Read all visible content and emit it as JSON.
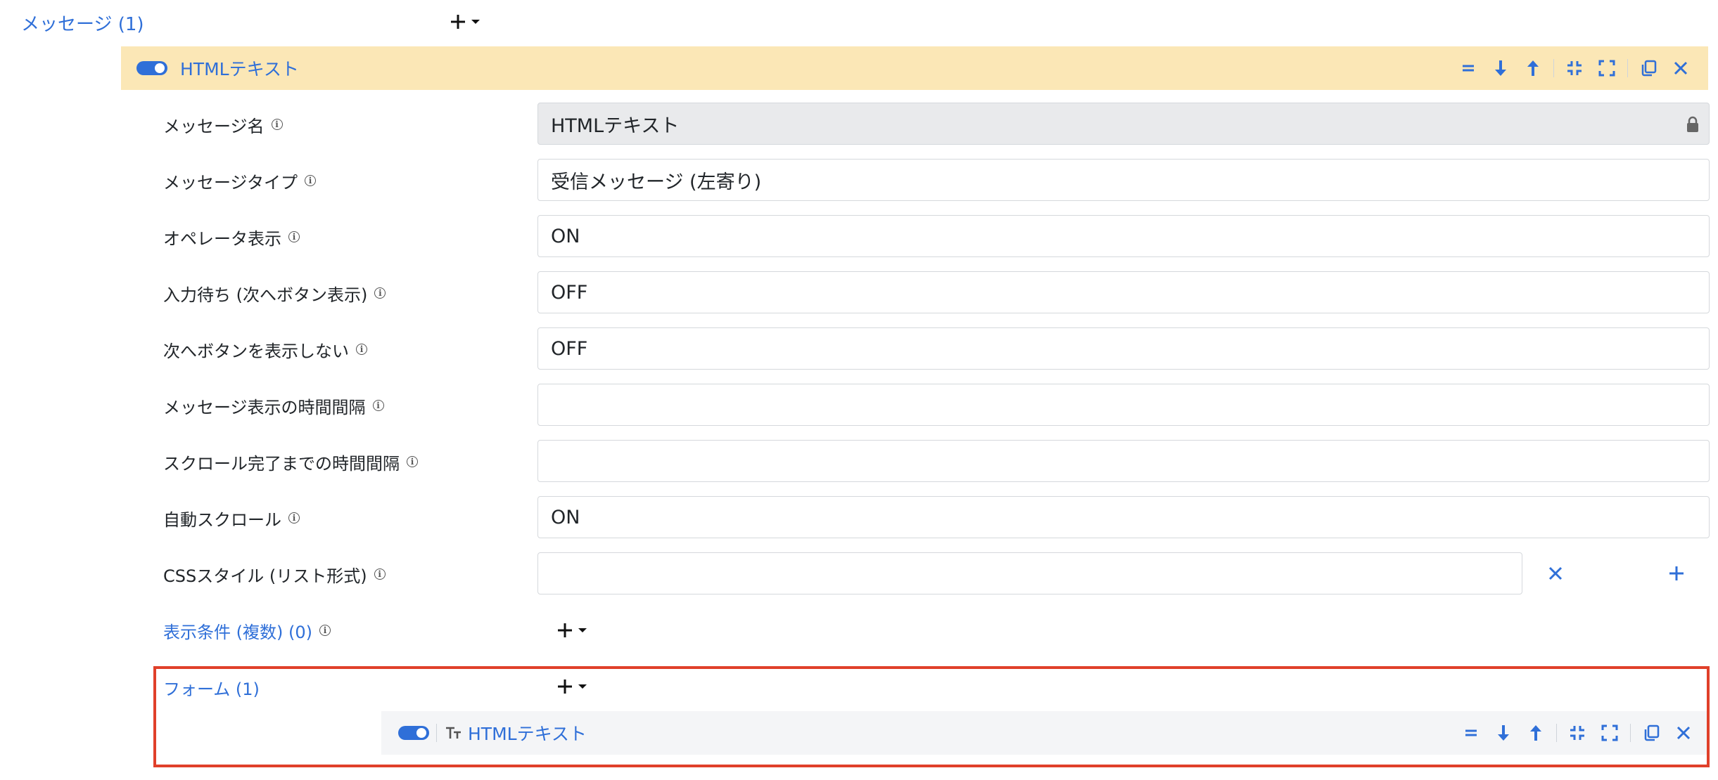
{
  "messages_section": {
    "label": "メッセージ (1)"
  },
  "message_header": {
    "title": "HTMLテキスト",
    "toolbar_icons": [
      "equals-icon",
      "arrow-down-icon",
      "arrow-up-icon",
      "collapse-icon",
      "expand-icon",
      "copy-icon",
      "close-icon"
    ]
  },
  "fields": [
    {
      "label": "メッセージ名",
      "value": "HTMLテキスト",
      "readonly": true
    },
    {
      "label": "メッセージタイプ",
      "value": "受信メッセージ (左寄り)"
    },
    {
      "label": "オペレータ表示",
      "value": "ON"
    },
    {
      "label": "入力待ち (次へボタン表示)",
      "value": "OFF"
    },
    {
      "label": "次へボタンを表示しない",
      "value": "OFF"
    },
    {
      "label": "メッセージ表示の時間間隔",
      "value": ""
    },
    {
      "label": "スクロール完了までの時間間隔",
      "value": ""
    },
    {
      "label": "自動スクロール",
      "value": "ON"
    },
    {
      "label": "CSSスタイル (リスト形式)",
      "value": ""
    }
  ],
  "conditions_section": {
    "label": "表示条件 (複数) (0)"
  },
  "form_section": {
    "label": "フォーム (1)",
    "item_title": "HTMLテキスト"
  },
  "colors": {
    "accent": "#2f6fd8",
    "header_bg": "#fbe7b6",
    "highlight_border": "#e0402a"
  }
}
